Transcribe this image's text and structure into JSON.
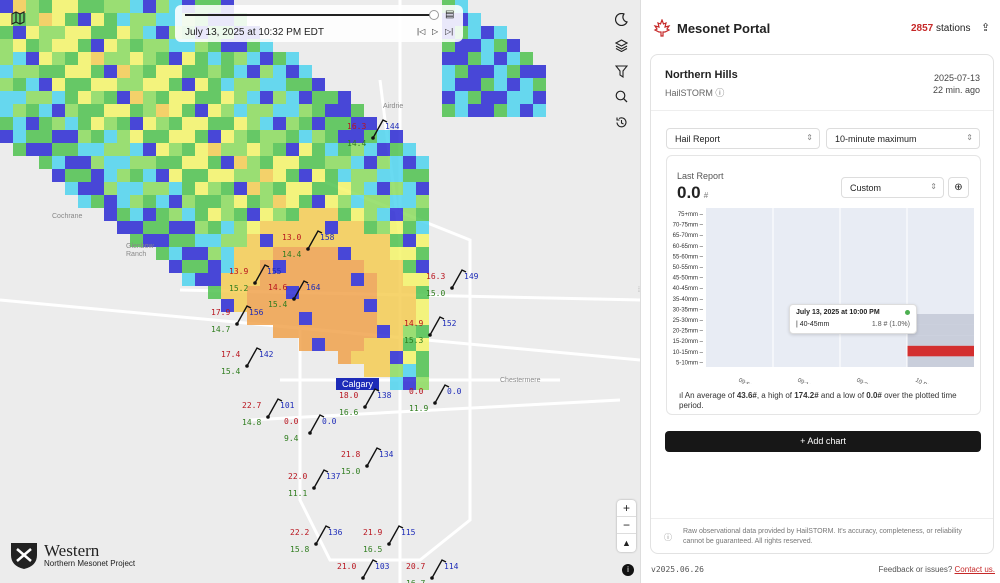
{
  "header": {
    "title": "Mesonet Portal",
    "station_count": "2857",
    "station_label": "stations"
  },
  "timeline": {
    "label": "July 13, 2025 at 10:32 PM EDT"
  },
  "card": {
    "station": "Northern Hills",
    "source": "HailSTORM",
    "date": "2025-07-13",
    "ago": "22 min. ago"
  },
  "selects": {
    "metric": "Hail Report",
    "agg": "10-minute maximum",
    "range": "Custom"
  },
  "last": {
    "label": "Last Report",
    "value": "0.0",
    "unit": "#"
  },
  "chart_data": {
    "type": "heatmap",
    "y_categories": [
      "75+mm",
      "70-75mm",
      "65-70mm",
      "60-65mm",
      "55-60mm",
      "50-55mm",
      "45-50mm",
      "40-45mm",
      "35-40mm",
      "30-35mm",
      "25-30mm",
      "20-25mm",
      "15-20mm",
      "10-15mm",
      "5-10mm"
    ],
    "x_ticks": [
      "09:50",
      "09:10",
      "09:30",
      "10 PM"
    ],
    "highlight": {
      "category": "10-15mm",
      "color": "#d32f2f"
    },
    "tooltip": {
      "title": "July 13, 2025 at 10:00 PM",
      "row": "| 40-45mm",
      "value": "1.8 # (1.0%)"
    }
  },
  "summary": {
    "p1": "An average of ",
    "avg": "43.6#",
    "p2": ", a high of ",
    "high": "174.2#",
    "p3": " and a low of ",
    "low": "0.0#",
    "p4": " over the plotted time period."
  },
  "add_chart": "Add chart",
  "disclaimer": "Raw observational data provided by HailSTORM. It's accuracy, completeness, or reliability cannot be guaranteed. All rights reserved.",
  "version": "v2025.06.26",
  "feedback": "Feedback or issues?",
  "contact": "Contact us.",
  "logo": {
    "name": "Western",
    "sub": "Northern Mesonet Project"
  },
  "places": {
    "airdrie": "Airdrie",
    "cochrane": "Cochrane",
    "glenbow": "Glenbow Ranch",
    "chestermere": "Chestermere",
    "calgary": "Calgary"
  },
  "stations": [
    {
      "t": "16.3",
      "d": "14.4",
      "p": "144"
    },
    {
      "t": "16.3",
      "d": "15.0",
      "p": "149"
    },
    {
      "t": "17.9",
      "d": "14.7",
      "p": "156"
    },
    {
      "t": "17.4",
      "d": "15.4",
      "p": "142"
    },
    {
      "t": "13.9",
      "d": "15.2",
      "p": "155"
    },
    {
      "t": "14.6",
      "d": "15.4",
      "p": "164"
    },
    {
      "t": "14.9",
      "d": "15.3",
      "p": "152"
    },
    {
      "t": "13.0",
      "d": "14.4",
      "p": "158"
    },
    {
      "t": "18.0",
      "d": "16.6",
      "p": "138"
    },
    {
      "t": "0.0",
      "d": "11.9",
      "p": "0.0"
    },
    {
      "t": "22.7",
      "d": "14.8",
      "p": "101"
    },
    {
      "t": "0.0",
      "d": "9.4",
      "p": "0.0"
    },
    {
      "t": "21.8",
      "d": "15.0",
      "p": "134"
    },
    {
      "t": "22.0",
      "d": "11.1",
      "p": "137"
    },
    {
      "t": "22.2",
      "d": "15.8",
      "p": "136"
    },
    {
      "t": "21.9",
      "d": "16.5",
      "p": "115"
    },
    {
      "t": "21.0",
      "d": "",
      "p": "103"
    },
    {
      "t": "20.7",
      "d": "16.7",
      "p": "114"
    }
  ]
}
